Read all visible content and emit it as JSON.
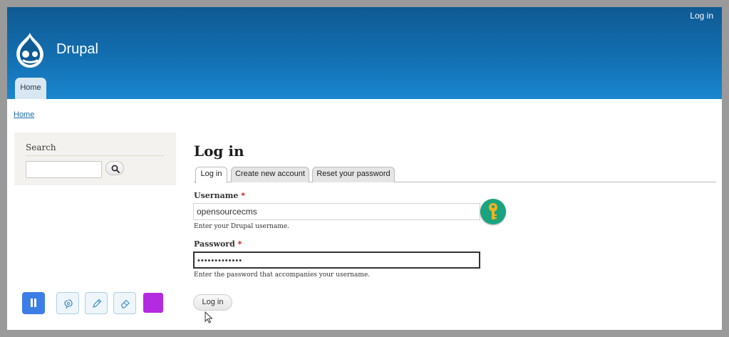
{
  "header": {
    "site_name": "Drupal",
    "login_link": "Log in",
    "nav_home": "Home"
  },
  "breadcrumb": "Home",
  "search": {
    "title": "Search",
    "input_value": ""
  },
  "main": {
    "title": "Log in",
    "tabs": [
      {
        "label": "Log in",
        "active": true
      },
      {
        "label": "Create new account",
        "active": false
      },
      {
        "label": "Reset your password",
        "active": false
      }
    ],
    "username": {
      "label": "Username",
      "required_mark": "*",
      "value": "opensourcecms",
      "description": "Enter your Drupal username."
    },
    "password": {
      "label": "Password",
      "required_mark": "*",
      "masked_value": "•••••••••••••",
      "description": "Enter the password that accompanies your username."
    },
    "submit_label": "Log in"
  },
  "icons": {
    "logo": "drupal-drop-logo",
    "search_button": "magnifier-icon",
    "password_manager": "key-icon",
    "toolbar": [
      "pause-icon",
      "lasso-icon",
      "pencil-icon",
      "eraser-icon"
    ]
  },
  "colors": {
    "header_top": "#0f5a93",
    "header_bottom": "#1a86cf",
    "key_badge": "#1aa37f",
    "pause_button": "#3d7ee6",
    "color_swatch": "#b42ae0",
    "required": "#c2110f"
  }
}
